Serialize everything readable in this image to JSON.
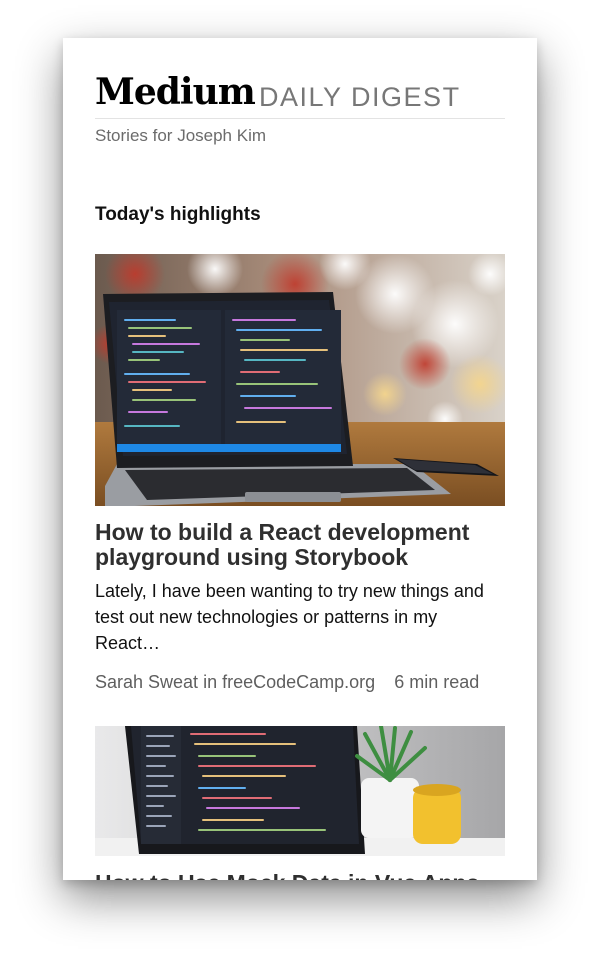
{
  "header": {
    "brand": "Medium",
    "product": "DAILY DIGEST",
    "subtitle": "Stories for Joseph Kim"
  },
  "section": {
    "title": "Today's highlights"
  },
  "stories": [
    {
      "title": "How to build a React development playground using Storybook",
      "excerpt": "Lately, I have been wanting to try new things and test out new technologies or patterns in my React…",
      "author": "Sarah Sweat",
      "in_word": "in",
      "publication": "freeCodeCamp.org",
      "read_time": "6 min read",
      "image_icon": "laptop-photo"
    },
    {
      "title": "How to Use Mock Data in Vue Apps",
      "image_icon": "laptop-plant-photo"
    }
  ],
  "colors": {
    "title_text": "#2f2f2f",
    "meta_text": "#5f5f5f",
    "brand_gray": "#777777"
  }
}
